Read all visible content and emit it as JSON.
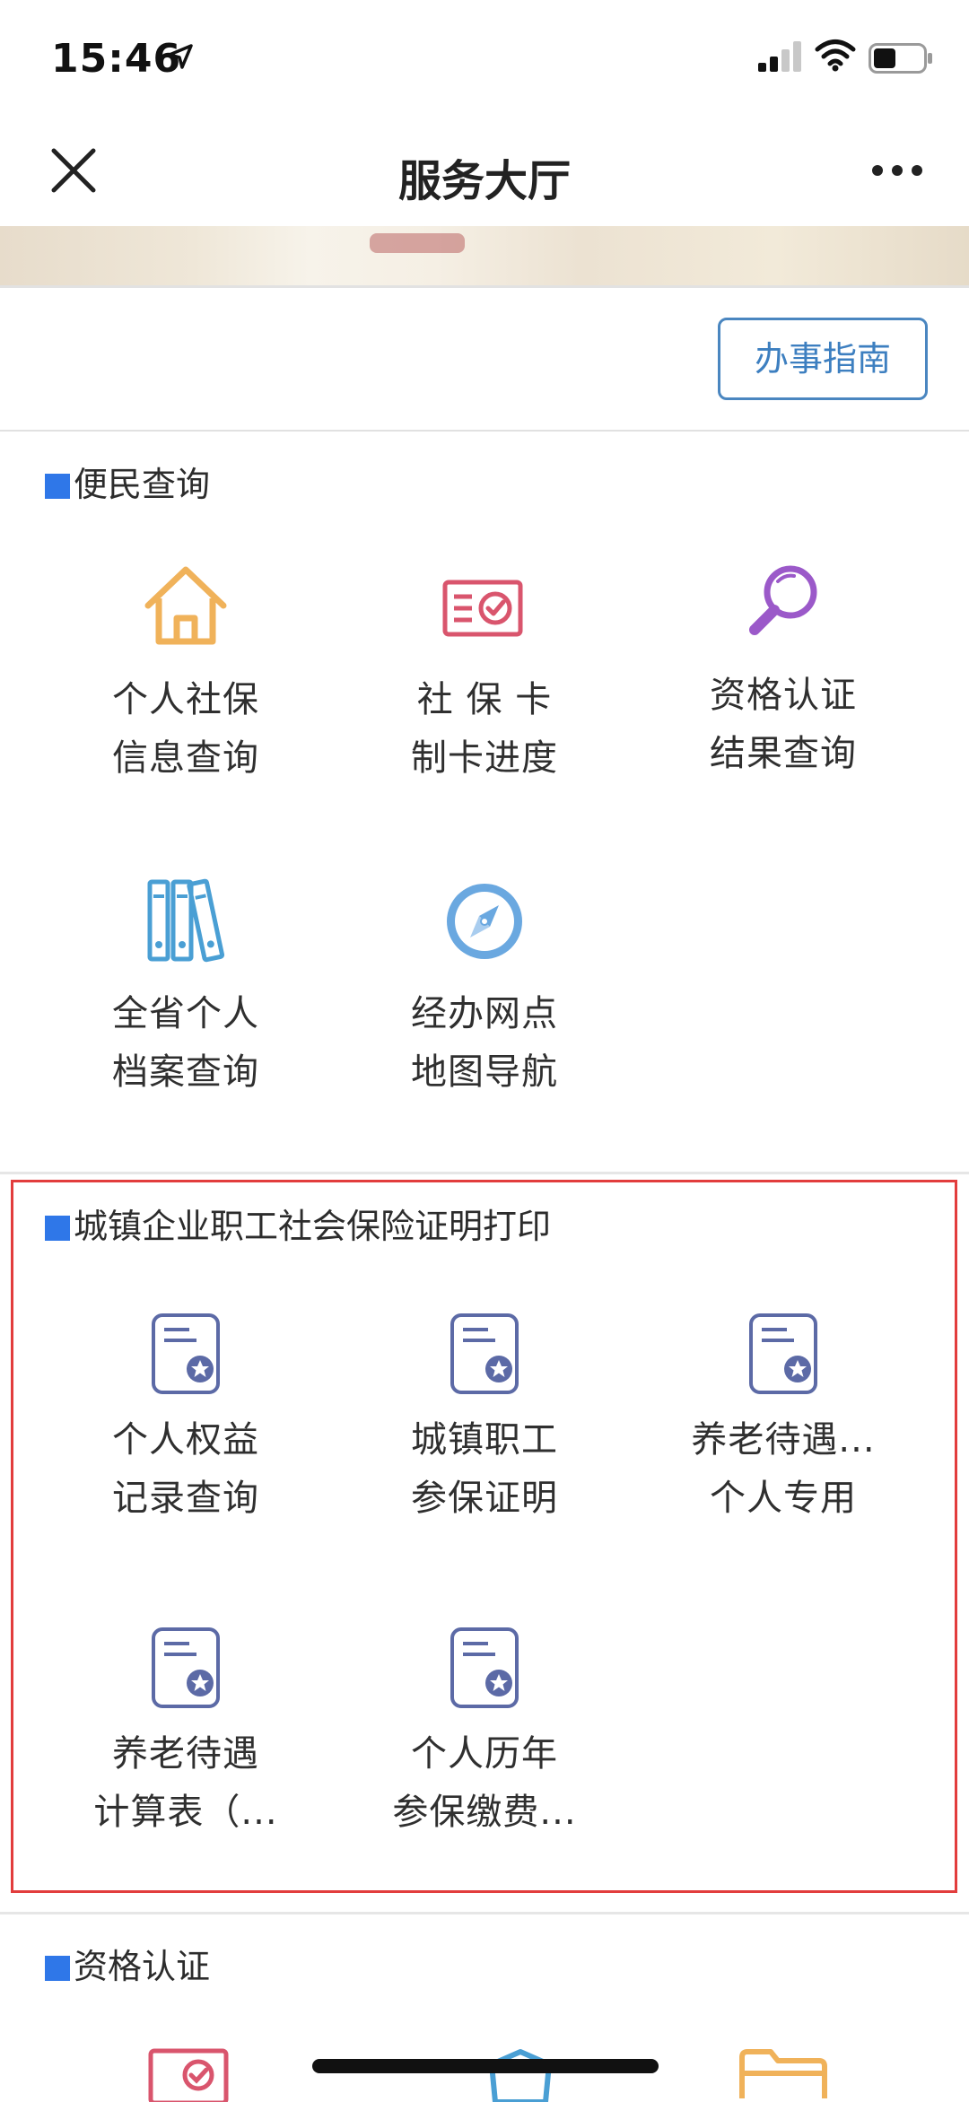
{
  "status_bar": {
    "time": "15:46"
  },
  "nav": {
    "title": "服务大厅"
  },
  "guide_button": "办事指南",
  "sections": [
    {
      "title": "便民查询",
      "items": [
        {
          "line1": "个人社保",
          "line2": "信息查询",
          "icon": "house-icon"
        },
        {
          "line1": "社 保 卡",
          "line2": "制卡进度",
          "icon": "card-check-icon"
        },
        {
          "line1": "资格认证",
          "line2": "结果查询",
          "icon": "magnifier-icon"
        },
        {
          "line1": "全省个人",
          "line2": "档案查询",
          "icon": "binders-icon"
        },
        {
          "line1": "经办网点",
          "line2": "地图导航",
          "icon": "compass-icon"
        }
      ]
    },
    {
      "title": "城镇企业职工社会保险证明打印",
      "items": [
        {
          "line1": "个人权益",
          "line2": "记录查询",
          "icon": "certificate-icon"
        },
        {
          "line1": "城镇职工",
          "line2": "参保证明",
          "icon": "certificate-icon"
        },
        {
          "line1": "养老待遇...",
          "line2": "个人专用",
          "icon": "certificate-icon"
        },
        {
          "line1": "养老待遇",
          "line2": "计算表（...",
          "icon": "certificate-icon"
        },
        {
          "line1": "个人历年",
          "line2": "参保缴费...",
          "icon": "certificate-icon"
        }
      ]
    },
    {
      "title": "资格认证",
      "items": []
    }
  ],
  "colors": {
    "accent": "#2f77e8",
    "guide_border": "#4a86c0",
    "highlight": "#e23d3d",
    "house": "#f0b25a",
    "card": "#d9556d",
    "magnifier": "#9b59c9",
    "binders": "#4a9fd4",
    "compass": "#6aa8e0",
    "certificate": "#5c6aa6"
  }
}
